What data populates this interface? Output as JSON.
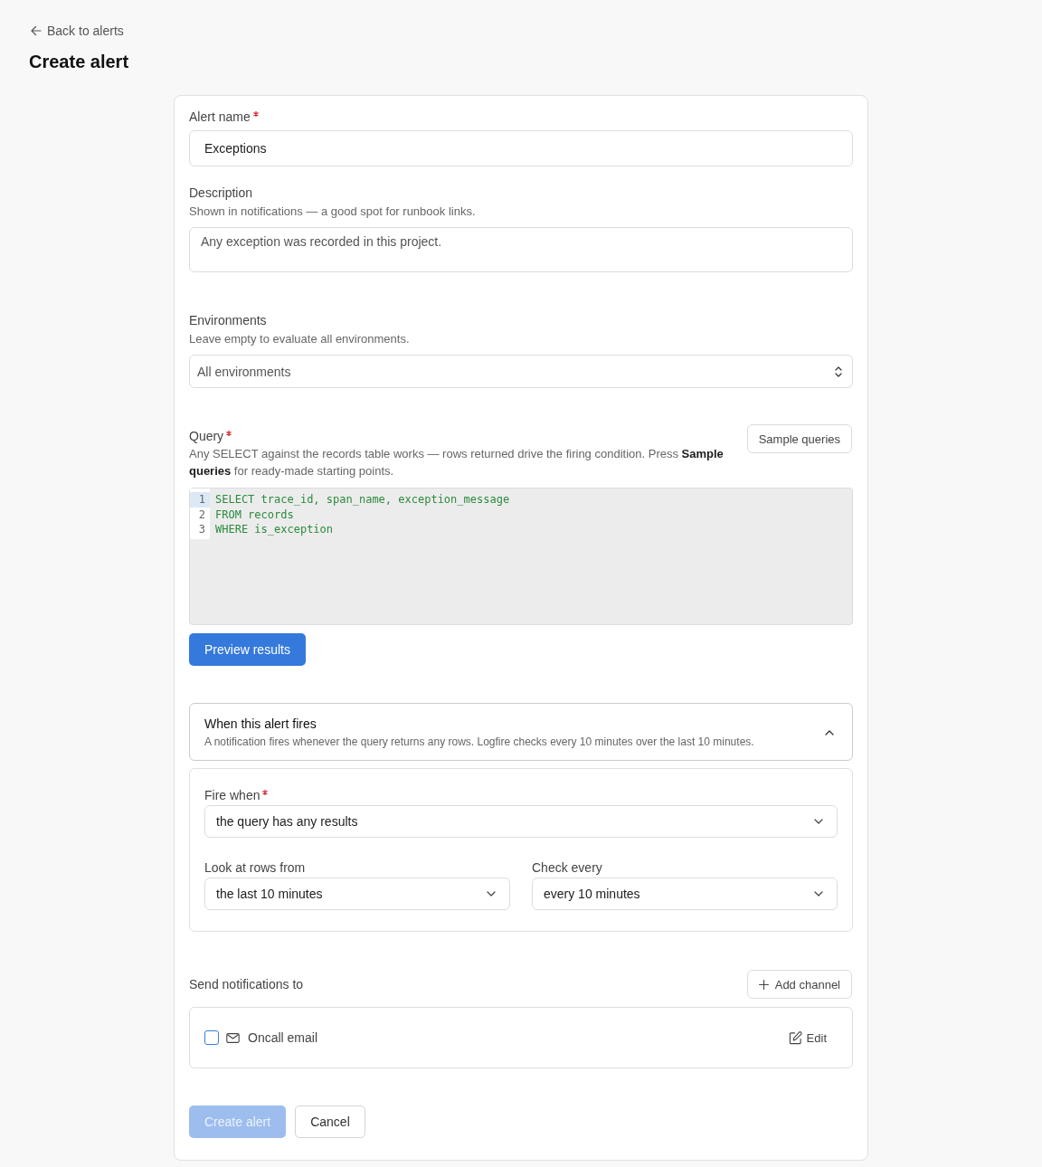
{
  "back_link": {
    "label": "Back to alerts"
  },
  "page_title": "Create alert",
  "alert_name": {
    "label": "Alert name",
    "required": true,
    "value": "Exceptions"
  },
  "description": {
    "label": "Description",
    "required": false,
    "hint": "Shown in notifications — a good spot for runbook links.",
    "value": "Any exception was recorded in this project."
  },
  "environments": {
    "label": "Environments",
    "required": false,
    "hint": "Leave empty to evaluate all environments.",
    "placeholder": "All environments"
  },
  "query": {
    "label": "Query",
    "required": true,
    "hint": "Any SELECT against the records table works — rows returned drive the firing condition. Press **Sample queries** for ready-made starting points.",
    "sample_button": "Sample queries",
    "lines": [
      {
        "number": "1",
        "code": "SELECT trace_id, span_name, exception_message",
        "selected": true
      },
      {
        "number": "2",
        "code": "FROM records",
        "selected": false
      },
      {
        "number": "3",
        "code": "WHERE is_exception",
        "selected": false
      }
    ],
    "preview_button": "Preview results"
  },
  "firing": {
    "title": "When this alert fires",
    "description": "A notification fires whenever the query returns any rows. Logfire checks every 10 minutes over the last 10 minutes.",
    "expanded": true,
    "rows": [
      {
        "fields": [
          {
            "label": "Fire when",
            "required": true,
            "value": "the query has any results"
          }
        ]
      },
      {
        "fields": [
          {
            "label": "Look at rows from",
            "required": false,
            "value": "the last 10 minutes"
          },
          {
            "label": "Check every",
            "required": false,
            "value": "every 10 minutes"
          }
        ]
      }
    ]
  },
  "notifications": {
    "label": "Send notifications to",
    "add_button": "Add channel",
    "channels": [
      {
        "name": "Oncall email",
        "checked": false,
        "edit_button": "Edit"
      }
    ]
  },
  "actions": [
    {
      "label": "Create alert",
      "kind": "primary",
      "disabled": true
    },
    {
      "label": "Cancel",
      "kind": "secondary",
      "disabled": false
    }
  ]
}
